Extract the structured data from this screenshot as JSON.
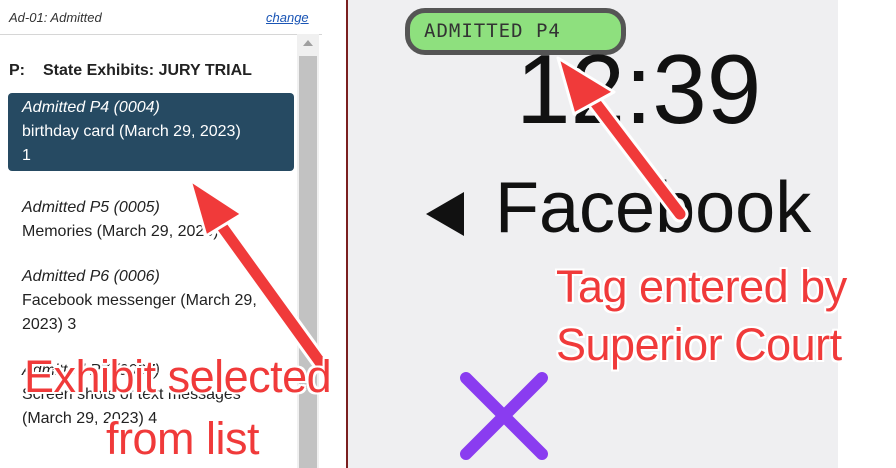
{
  "header": {
    "title": "Ad-01: Admitted",
    "change_label": "change"
  },
  "section": {
    "prefix": "P:",
    "title": "State Exhibits: JURY TRIAL"
  },
  "exhibits": [
    {
      "tag": "Admitted P4 (0004)",
      "description": "birthday card (March 29, 2023)",
      "number": "1",
      "selected": true
    },
    {
      "tag": "Admitted P5 (0005)",
      "description": "Memories (March 29, 2023) 2",
      "selected": false
    },
    {
      "tag": "Admitted P6 (0006)",
      "description": "Facebook messenger (March 29, 2023) 3",
      "selected": false
    },
    {
      "tag": "Admitted P7 (0007)",
      "description": "Screen shots of text messages (March 29, 2023) 4",
      "selected": false
    }
  ],
  "preview": {
    "tag_label": "ADMITTED P4",
    "clock": "12:39",
    "back_label": "Facebook"
  },
  "annotations": {
    "left_line1": "Exhibit selected",
    "left_line2": "from list",
    "right_line1": "Tag entered by",
    "right_line2": "Superior Court"
  },
  "colors": {
    "selected_bg": "#264a62",
    "tag_green": "#8ee07e",
    "annotation_red": "#f03a3a",
    "x_purple": "#8a3cf0"
  }
}
